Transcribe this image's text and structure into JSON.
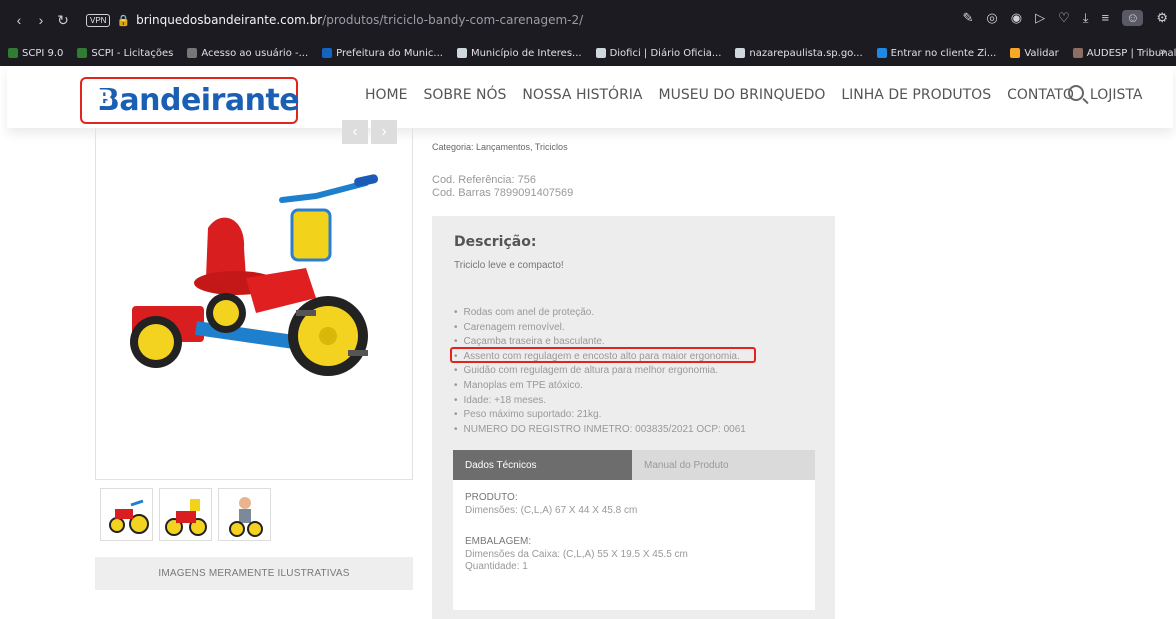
{
  "browser": {
    "vpn_label": "VPN",
    "url_domain": "brinquedosbandeirante.com.br",
    "url_path": "/produtos/triciclo-bandy-com-carenagem-2/",
    "bookmarks": [
      {
        "label": "SCPI 9.0",
        "color": "#2e7d32"
      },
      {
        "label": "SCPI - Licitações",
        "color": "#2e7d32"
      },
      {
        "label": "Acesso ao usuário -...",
        "color": "#777777"
      },
      {
        "label": "Prefeitura do Munic...",
        "color": "#1565c0"
      },
      {
        "label": "Município de Interes...",
        "color": "#cfd8dc"
      },
      {
        "label": "Diofici | Diário Oficia...",
        "color": "#cfd8dc"
      },
      {
        "label": "nazarepaulista.sp.go...",
        "color": "#cfd8dc"
      },
      {
        "label": "Entrar no cliente Zi...",
        "color": "#1e88e5"
      },
      {
        "label": "Validar",
        "color": "#f9a825"
      },
      {
        "label": "AUDESP | Tribunal d...",
        "color": "#8d6e63"
      }
    ]
  },
  "header": {
    "logo_text": "Bandeirante",
    "nav": [
      "HOME",
      "SOBRE NÓS",
      "NOSSA HISTÓRIA",
      "MUSEU DO BRINQUEDO",
      "LINHA DE PRODUTOS",
      "CONTATO",
      "LOJISTA"
    ]
  },
  "gallery": {
    "caption": "IMAGENS MERAMENTE ILUSTRATIVAS",
    "prev": "‹",
    "next": "›"
  },
  "product": {
    "category": "Categoria: Lançamentos, Triciclos",
    "ref": "Cod. Referência: 756",
    "barcode": "Cod. Barras 7899091407569",
    "desc_title": "Descrição:",
    "desc_subtitle": "Triciclo leve e compacto!",
    "features": [
      "Rodas com anel de proteção.",
      "Carenagem removível.",
      "Caçamba traseira e basculante.",
      "Assento com regulagem e encosto alto para maior ergonomia.",
      "Guidão com regulagem de altura para melhor ergonomia.",
      "Manoplas em TPE atóxico.",
      "Idade: +18 meses.",
      "Peso máximo suportado: 21kg.",
      "NUMERO DO REGISTRO INMETRO: 003835/2021 OCP: 0061"
    ],
    "tabs": {
      "active": "Dados Técnicos",
      "inactive": "Manual do Produto"
    },
    "tech": {
      "produto_label": "PRODUTO:",
      "produto_dims": "Dimensões: (C,L,A) 67 X 44 X 45.8 cm",
      "emb_label": "EMBALAGEM:",
      "emb_dims": "Dimensões da Caixa: (C,L,A) 55 X 19.5 X 45.5 cm",
      "qty": "Quantidade: 1"
    }
  },
  "colors": {
    "brand_blue": "#1a5fb4",
    "brand_red": "#e3241b"
  }
}
